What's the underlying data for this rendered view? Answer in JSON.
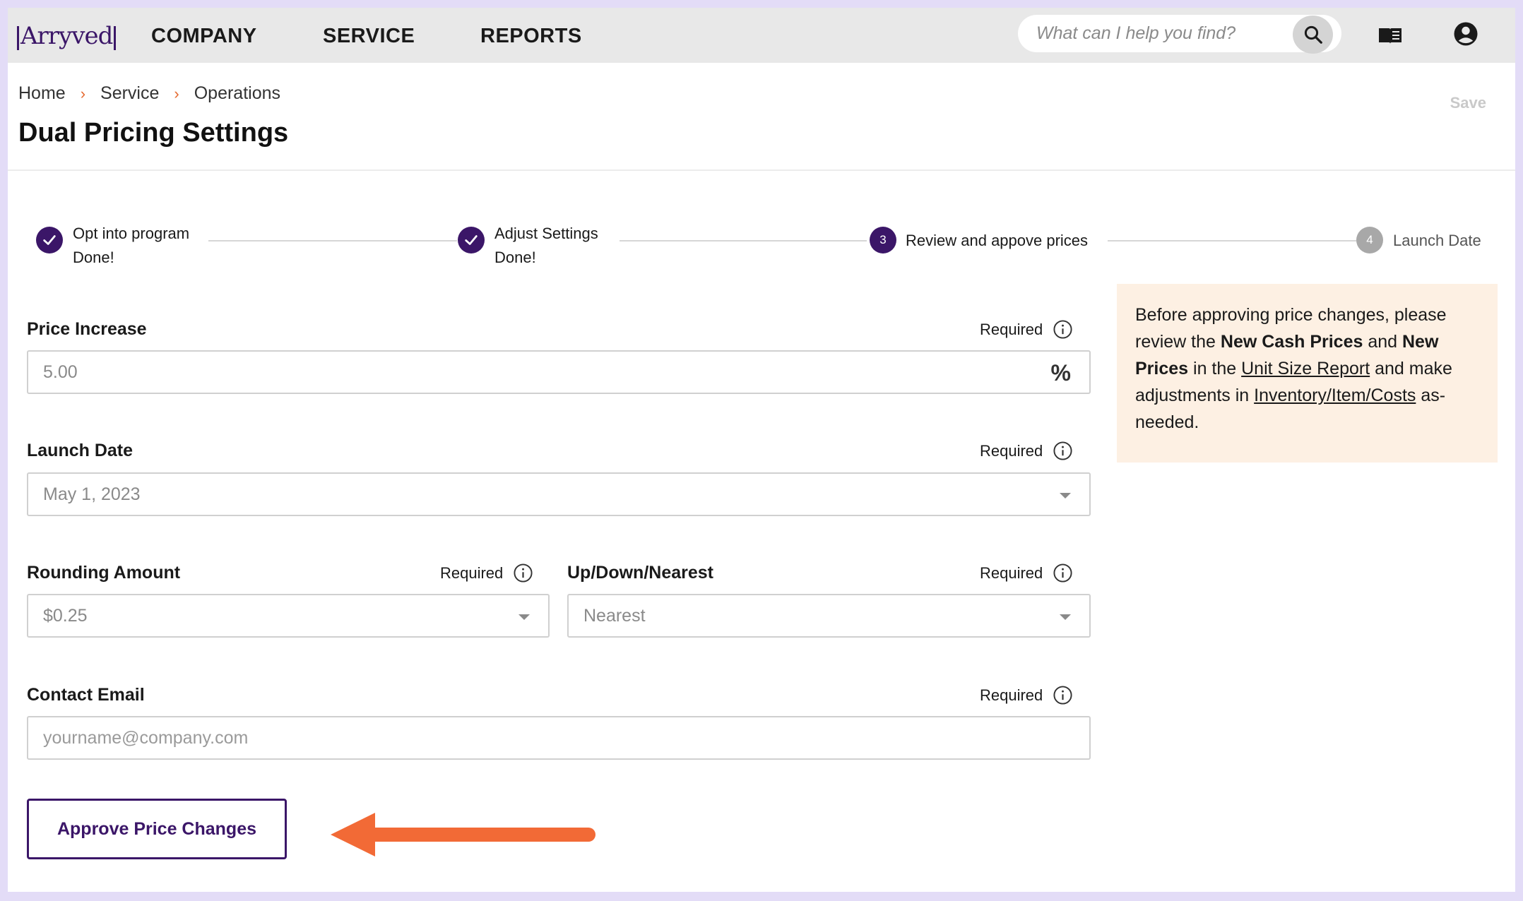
{
  "app": {
    "logo_text": "Arryved"
  },
  "nav": {
    "links": [
      "COMPANY",
      "SERVICE",
      "REPORTS"
    ],
    "search_placeholder": "What can I help you find?",
    "icons": [
      "search-icon",
      "book-icon",
      "account-icon"
    ]
  },
  "header": {
    "breadcrumb": [
      "Home",
      "Service",
      "Operations"
    ],
    "title": "Dual Pricing Settings",
    "save_label": "Save"
  },
  "stepper": {
    "steps": [
      {
        "label": "Opt into program",
        "status_text": "Done!",
        "state": "done"
      },
      {
        "label": "Adjust Settings",
        "status_text": "Done!",
        "state": "done"
      },
      {
        "number": "3",
        "label": "Review and appove prices",
        "state": "active"
      },
      {
        "number": "4",
        "label": "Launch Date",
        "state": "pending"
      }
    ]
  },
  "form": {
    "required_text": "Required",
    "price_increase": {
      "label": "Price Increase",
      "value": "5.00",
      "suffix": "%"
    },
    "launch_date": {
      "label": "Launch Date",
      "value": "May 1, 2023"
    },
    "rounding_amount": {
      "label": "Rounding Amount",
      "value": "$0.25"
    },
    "rounding_direction": {
      "label": "Up/Down/Nearest",
      "value": "Nearest"
    },
    "contact_email": {
      "label": "Contact Email",
      "placeholder": "yourname@company.com"
    },
    "approve_label": "Approve Price Changes"
  },
  "callout": {
    "t1": "Before approving price changes, please review the ",
    "b1": "New Cash Prices",
    "t2": " and ",
    "b2": "New Prices",
    "t3": " in the ",
    "link1": "Unit Size Report",
    "t4": " and make adjustments in ",
    "link2": "Inventory/Item/Costs",
    "t5": " as-needed."
  },
  "colors": {
    "brand": "#3b1668",
    "accent_arrow": "#f26a36",
    "breadcrumb_separator": "#e5692f",
    "callout_bg": "#fdf0e3",
    "frame_border": "#e3dcf7"
  }
}
